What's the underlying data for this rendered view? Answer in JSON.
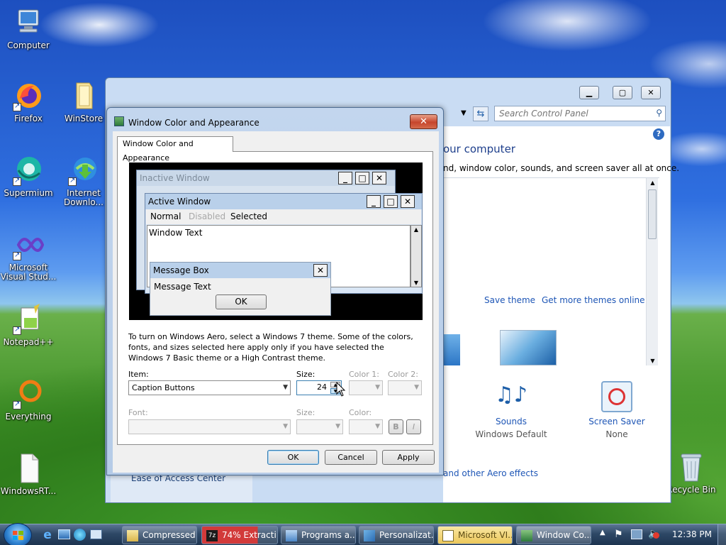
{
  "desktop": {
    "icons": [
      {
        "label": "Computer"
      },
      {
        "label": "Firefox"
      },
      {
        "label": "WinStore"
      },
      {
        "label": "Supermium"
      },
      {
        "label": "Internet Downlo..."
      },
      {
        "label": "Microsoft Visual Stud..."
      },
      {
        "label": "Notepad++"
      },
      {
        "label": "Everything"
      },
      {
        "label": "WindowsRT..."
      },
      {
        "label": "Recycle Bin"
      }
    ]
  },
  "control_panel": {
    "search_placeholder": "Search Control Panel",
    "heading": "our computer",
    "subtext": "nd, window color, sounds, and screen saver all at once.",
    "save_theme": "Save theme",
    "more_themes": "Get more themes online",
    "sounds_label": "Sounds",
    "sounds_value": "Windows Default",
    "screensaver_label": "Screen Saver",
    "screensaver_value": "None",
    "aero_link": "and other Aero effects",
    "ease_of_access": "Ease of Access Center"
  },
  "dialog": {
    "title": "Window Color and Appearance",
    "tab_label": "Window Color and Appearance",
    "preview": {
      "inactive_title": "Inactive Window",
      "active_title": "Active Window",
      "menu_normal": "Normal",
      "menu_disabled": "Disabled",
      "menu_selected": "Selected",
      "window_text": "Window Text",
      "message_box_title": "Message Box",
      "message_text": "Message Text",
      "ok_label": "OK"
    },
    "description": "To turn on Windows Aero, select a Windows 7 theme.  Some of the colors, fonts, and sizes selected here apply only if you have selected the Windows 7 Basic theme or a High Contrast theme.",
    "item_label": "Item:",
    "item_value": "Caption Buttons",
    "size_label": "Size:",
    "size_value": "24",
    "color1_label": "Color 1:",
    "color2_label": "Color 2:",
    "font_label": "Font:",
    "font_size_label": "Size:",
    "font_color_label": "Color:",
    "bold_label": "B",
    "italic_label": "I",
    "ok_button": "OK",
    "cancel_button": "Cancel",
    "apply_button": "Apply"
  },
  "taskbar": {
    "tasks": [
      {
        "label": "Compressed"
      },
      {
        "label": "74% Extracti..."
      },
      {
        "label": "Programs a..."
      },
      {
        "label": "Personalizat..."
      },
      {
        "label": "Microsoft VI..."
      },
      {
        "label": "Window Co..."
      }
    ],
    "clock": "12:38 PM",
    "extraction_color": "#c8262b"
  }
}
